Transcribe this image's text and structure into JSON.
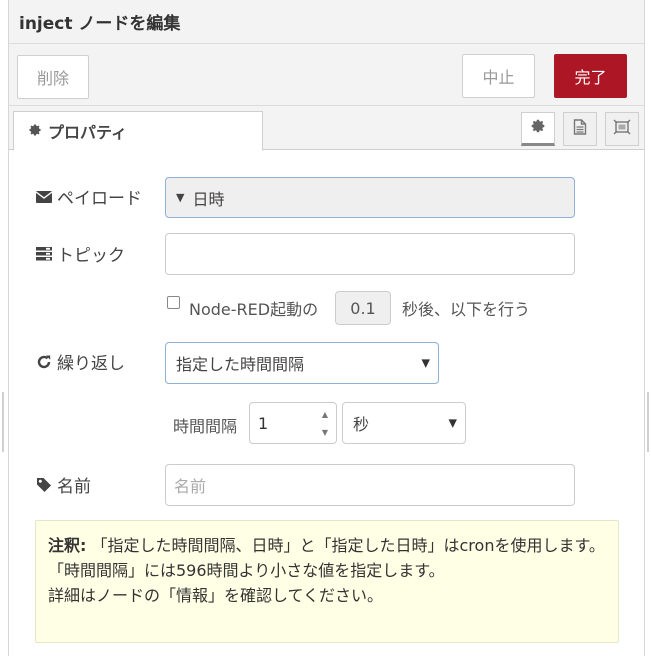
{
  "header": {
    "title": "inject ノードを編集"
  },
  "toolbar": {
    "delete_label": "削除",
    "cancel_label": "中止",
    "done_label": "完了"
  },
  "tabs": {
    "properties_label": "プロパティ"
  },
  "payload": {
    "label": "ペイロード",
    "value": "日時"
  },
  "topic": {
    "label": "トピック",
    "value": ""
  },
  "startup": {
    "label": "Node-RED起動の",
    "delay": "0.1",
    "suffix": "秒後、以下を行う",
    "checked": false
  },
  "repeat": {
    "label": "繰り返し",
    "selected": "指定した時間間隔"
  },
  "interval": {
    "label": "時間間隔",
    "value": "1",
    "unit": "秒"
  },
  "name": {
    "label": "名前",
    "placeholder": "名前"
  },
  "note": {
    "heading": "注釈:",
    "line1": "「指定した時間間隔、日時」と「指定した日時」はcronを使用します。",
    "line2": "「時間間隔」には596時間より小さな値を指定します。",
    "line3": "詳細はノードの「情報」を確認してください。"
  },
  "colors": {
    "primary": "#ad1625",
    "focus_border": "#8eb1d4",
    "note_bg": "#ffffe6"
  }
}
